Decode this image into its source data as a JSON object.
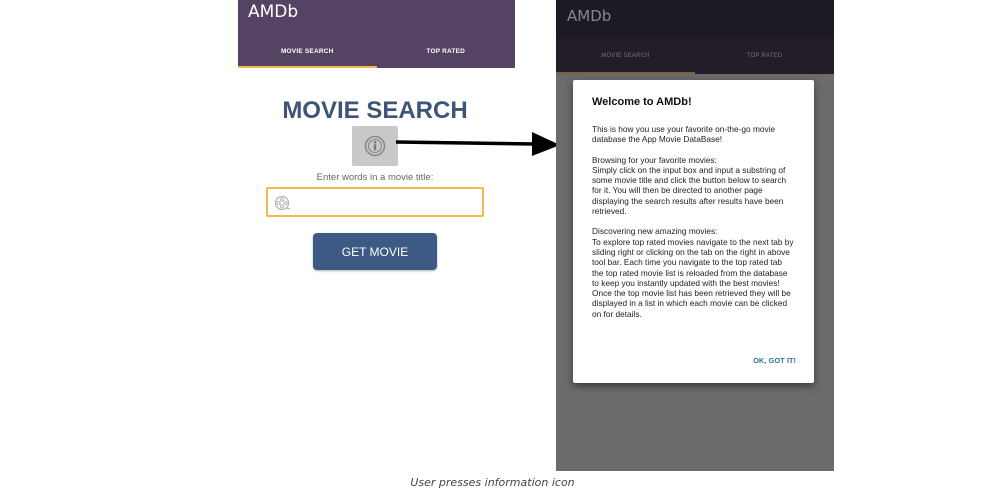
{
  "left": {
    "app_title": "AMDb",
    "tabs": [
      {
        "label": "MOVIE SEARCH",
        "active": true
      },
      {
        "label": "TOP RATED",
        "active": false
      }
    ],
    "page_title": "MOVIE SEARCH",
    "hint": "Enter words in a movie title:",
    "search": {
      "value": "",
      "placeholder": ""
    },
    "get_movie_label": "GET MOVIE"
  },
  "right": {
    "app_title": "AMDb",
    "tabs": [
      {
        "label": "MOVIE SEARCH",
        "active": true
      },
      {
        "label": "TOP RATED",
        "active": false
      }
    ],
    "dialog": {
      "title": "Welcome to AMDb!",
      "paragraphs": [
        "This is how you use your favorite on-the-go movie database the App Movie DataBase!",
        "Browsing for your favorite movies:\nSimply click on the input box and input a substring of some movie title and click the button below to search for it. You will then be directed to another page displaying the search results after results have been retrieved.",
        "Discovering new amazing movies:\nTo explore top rated movies navigate to the next tab by sliding right or clicking on the tab on the right in above tool bar. Each time you navigate to the top rated tab the top rated movie list is reloaded from the database to keep you instantly updated with the best movies! Once the top movie list has been retrieved they will be displayed in a list in which each movie can be clicked on for details."
      ],
      "ok_label": "OK, GOT IT!"
    }
  },
  "caption": "User presses information icon",
  "colors": {
    "appbar": "#544362",
    "accent": "#f2b84b",
    "button": "#3d5a85",
    "title": "#3d5577",
    "dialog_button": "#2a7b88"
  },
  "icons": {
    "info": "info-icon",
    "film": "film-reel-icon",
    "arrow": "arrow-right-icon"
  }
}
